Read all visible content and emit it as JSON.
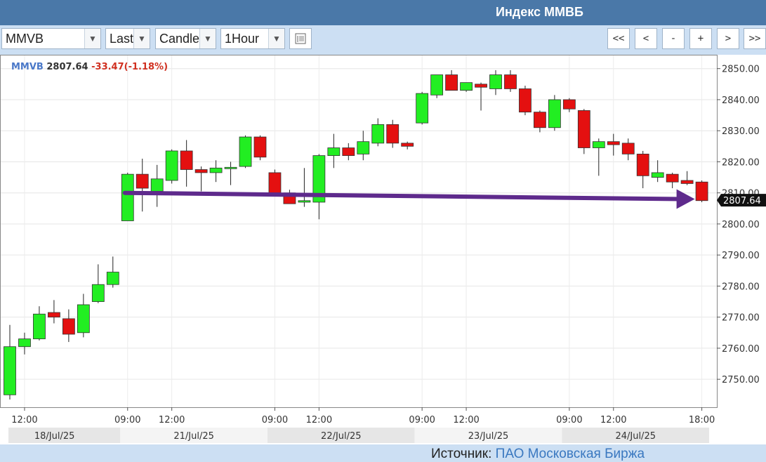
{
  "header": {
    "title": "Индекс ММВБ"
  },
  "toolbar": {
    "symbol": "MMVB",
    "price_field": "Last",
    "chart_style": "Candle",
    "interval": "1Hour",
    "nav_buttons": [
      "<<",
      "<",
      "-",
      "+",
      ">",
      ">>"
    ]
  },
  "info": {
    "symbol": "MMVB",
    "price": "2807.64",
    "change": "-33.47(-1.18%)"
  },
  "source": {
    "label": "Источник:",
    "link_text": "ПАО Московская Биржа"
  },
  "colors": {
    "up": "#22ee22",
    "down": "#e41010",
    "arrow": "#5e2a8c",
    "symbol_blue": "#4a78c8",
    "change_red": "#d03020"
  },
  "chart_data": {
    "type": "candlestick",
    "title": "",
    "xlabel": "",
    "ylabel": "",
    "ylim": [
      2741,
      2854
    ],
    "y_ticks": [
      "2750.00",
      "2760.00",
      "2770.00",
      "2780.00",
      "2790.00",
      "2800.00",
      "2810.00",
      "2820.00",
      "2830.00",
      "2840.00",
      "2850.00"
    ],
    "x_time_labels": [
      {
        "label": "12:00",
        "index": 1
      },
      {
        "label": "09:00",
        "index": 8
      },
      {
        "label": "12:00",
        "index": 11
      },
      {
        "label": "09:00",
        "index": 18
      },
      {
        "label": "12:00",
        "index": 21
      },
      {
        "label": "09:00",
        "index": 28
      },
      {
        "label": "12:00",
        "index": 31
      },
      {
        "label": "09:00",
        "index": 38
      },
      {
        "label": "12:00",
        "index": 41
      },
      {
        "label": "18:00",
        "index": 47
      }
    ],
    "date_bands": [
      {
        "label": "18/Jul/25",
        "from": 0,
        "to": 7
      },
      {
        "label": "21/Jul/25",
        "from": 8,
        "to": 17
      },
      {
        "label": "22/Jul/25",
        "from": 18,
        "to": 27
      },
      {
        "label": "23/Jul/25",
        "from": 28,
        "to": 37
      },
      {
        "label": "24/Jul/25",
        "from": 38,
        "to": 47
      }
    ],
    "last_price_label": "2807.64",
    "grid": true,
    "candles": [
      {
        "o": 2745.0,
        "h": 2767.5,
        "l": 2743.5,
        "c": 2760.5
      },
      {
        "o": 2760.5,
        "h": 2765.0,
        "l": 2758.0,
        "c": 2763.0
      },
      {
        "o": 2763.0,
        "h": 2773.5,
        "l": 2762.5,
        "c": 2771.0
      },
      {
        "o": 2771.5,
        "h": 2775.5,
        "l": 2768.0,
        "c": 2770.0
      },
      {
        "o": 2769.5,
        "h": 2772.5,
        "l": 2762.0,
        "c": 2764.5
      },
      {
        "o": 2765.0,
        "h": 2777.5,
        "l": 2763.5,
        "c": 2774.0
      },
      {
        "o": 2775.0,
        "h": 2787.0,
        "l": 2774.5,
        "c": 2780.5
      },
      {
        "o": 2780.5,
        "h": 2789.5,
        "l": 2779.5,
        "c": 2784.5
      },
      {
        "o": 2801.0,
        "h": 2816.5,
        "l": 2801.0,
        "c": 2816.0
      },
      {
        "o": 2816.0,
        "h": 2821.0,
        "l": 2804.0,
        "c": 2811.5
      },
      {
        "o": 2810.5,
        "h": 2819.0,
        "l": 2805.5,
        "c": 2814.5
      },
      {
        "o": 2814.0,
        "h": 2824.0,
        "l": 2813.0,
        "c": 2823.5
      },
      {
        "o": 2823.5,
        "h": 2827.0,
        "l": 2812.0,
        "c": 2817.5
      },
      {
        "o": 2817.5,
        "h": 2818.5,
        "l": 2810.5,
        "c": 2816.5
      },
      {
        "o": 2816.5,
        "h": 2820.5,
        "l": 2813.5,
        "c": 2818.0
      },
      {
        "o": 2818.0,
        "h": 2820.0,
        "l": 2812.5,
        "c": 2818.0
      },
      {
        "o": 2818.5,
        "h": 2828.5,
        "l": 2818.0,
        "c": 2828.0
      },
      {
        "o": 2828.0,
        "h": 2828.5,
        "l": 2820.5,
        "c": 2821.5
      },
      {
        "o": 2816.5,
        "h": 2817.5,
        "l": 2809.5,
        "c": 2810.0
      },
      {
        "o": 2810.0,
        "h": 2811.0,
        "l": 2806.5,
        "c": 2806.5
      },
      {
        "o": 2807.0,
        "h": 2818.0,
        "l": 2805.5,
        "c": 2807.5
      },
      {
        "o": 2807.0,
        "h": 2822.5,
        "l": 2801.5,
        "c": 2822.0
      },
      {
        "o": 2822.0,
        "h": 2829.0,
        "l": 2818.0,
        "c": 2824.5
      },
      {
        "o": 2824.5,
        "h": 2826.0,
        "l": 2820.5,
        "c": 2822.0
      },
      {
        "o": 2822.5,
        "h": 2830.0,
        "l": 2820.5,
        "c": 2826.5
      },
      {
        "o": 2826.0,
        "h": 2834.0,
        "l": 2825.0,
        "c": 2832.0
      },
      {
        "o": 2832.0,
        "h": 2833.5,
        "l": 2824.5,
        "c": 2826.0
      },
      {
        "o": 2826.0,
        "h": 2826.5,
        "l": 2824.0,
        "c": 2825.0
      },
      {
        "o": 2832.5,
        "h": 2842.5,
        "l": 2832.0,
        "c": 2842.0
      },
      {
        "o": 2841.5,
        "h": 2848.0,
        "l": 2840.5,
        "c": 2848.0
      },
      {
        "o": 2848.0,
        "h": 2849.5,
        "l": 2843.0,
        "c": 2843.0
      },
      {
        "o": 2843.0,
        "h": 2845.5,
        "l": 2842.5,
        "c": 2845.5
      },
      {
        "o": 2845.0,
        "h": 2845.5,
        "l": 2836.5,
        "c": 2844.0
      },
      {
        "o": 2843.5,
        "h": 2849.5,
        "l": 2841.5,
        "c": 2848.0
      },
      {
        "o": 2848.0,
        "h": 2849.5,
        "l": 2842.5,
        "c": 2843.5
      },
      {
        "o": 2843.5,
        "h": 2844.5,
        "l": 2835.0,
        "c": 2836.0
      },
      {
        "o": 2836.0,
        "h": 2836.5,
        "l": 2829.5,
        "c": 2831.0
      },
      {
        "o": 2831.0,
        "h": 2841.5,
        "l": 2830.0,
        "c": 2840.0
      },
      {
        "o": 2840.0,
        "h": 2840.5,
        "l": 2836.0,
        "c": 2837.0
      },
      {
        "o": 2836.5,
        "h": 2837.0,
        "l": 2822.5,
        "c": 2824.5
      },
      {
        "o": 2824.5,
        "h": 2827.5,
        "l": 2815.5,
        "c": 2826.5
      },
      {
        "o": 2826.5,
        "h": 2829.0,
        "l": 2822.0,
        "c": 2825.5
      },
      {
        "o": 2826.0,
        "h": 2827.5,
        "l": 2820.5,
        "c": 2822.5
      },
      {
        "o": 2822.5,
        "h": 2823.5,
        "l": 2811.5,
        "c": 2815.5
      },
      {
        "o": 2815.0,
        "h": 2820.5,
        "l": 2813.5,
        "c": 2816.5
      },
      {
        "o": 2816.0,
        "h": 2816.5,
        "l": 2811.5,
        "c": 2813.5
      },
      {
        "o": 2814.0,
        "h": 2817.0,
        "l": 2812.5,
        "c": 2813.0
      },
      {
        "o": 2813.5,
        "h": 2814.0,
        "l": 2807.0,
        "c": 2807.5
      }
    ],
    "annotations": [
      {
        "type": "arrow",
        "from_index": 8,
        "to_index": 47,
        "from_value": 2810.0,
        "to_value": 2808.0
      }
    ]
  }
}
